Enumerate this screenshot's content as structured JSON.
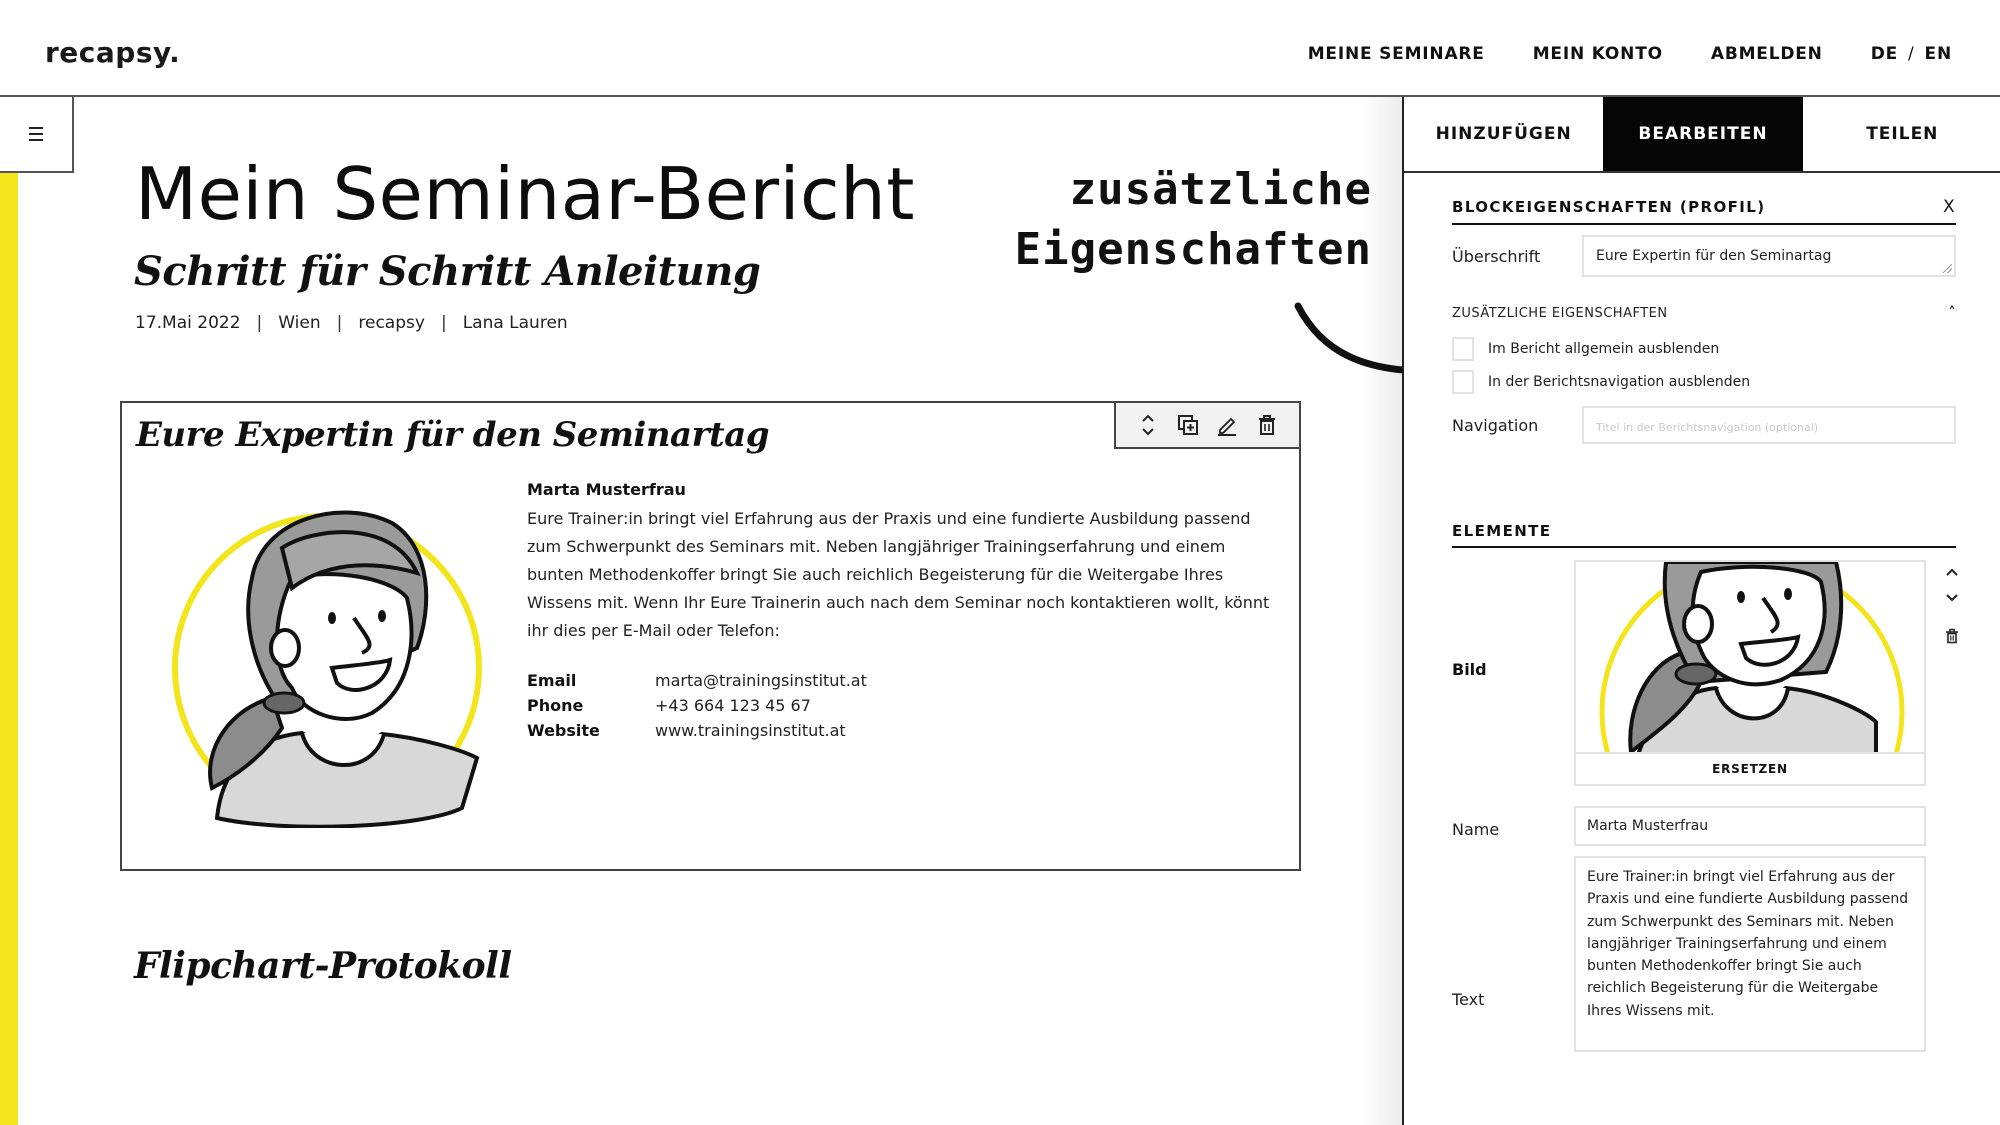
{
  "header": {
    "logo": "recapsy.",
    "nav": [
      {
        "label": "MEINE SEMINARE"
      },
      {
        "label": "MEIN KONTO"
      },
      {
        "label": "ABMELDEN"
      }
    ],
    "language": {
      "de": "DE",
      "separator": "/",
      "en": "EN"
    }
  },
  "sidebar_toggle": {
    "icon": "hamburger-menu-icon"
  },
  "main": {
    "title": "Mein Seminar-Bericht",
    "subtitle": "Schritt für Schritt Anleitung",
    "meta": {
      "date": "17.Mai 2022",
      "location": "Wien",
      "organizer": "recapsy",
      "author": "Lana Lauren",
      "separator": "|"
    },
    "annotation": {
      "line1": "zusätzliche",
      "line2": "Eigenschaften"
    },
    "profile_block": {
      "heading": "Eure Expertin für den Seminartag",
      "toolbar": [
        "move-up-down-icon",
        "duplicate-icon",
        "edit-pencil-icon",
        "trash-icon"
      ],
      "name": "Marta Musterfrau",
      "text": "Eure Trainer:in bringt viel Erfahrung aus der Praxis und eine fundierte Ausbildung passend zum Schwerpunkt des Seminars mit. Neben langjähriger Trainingserfahrung und einem bunten Methodenkoffer bringt Sie auch reichlich Begeisterung für die Weitergabe Ihres Wissens mit. Wenn Ihr Eure Trainerin auch nach dem Seminar noch kontaktieren wollt, könnt ihr dies per E-Mail oder Telefon:",
      "contacts": [
        {
          "label": "Email",
          "value": "marta@trainingsinstitut.at"
        },
        {
          "label": "Phone",
          "value": "+43 664 123 45 67"
        },
        {
          "label": "Website",
          "value": "www.trainingsinstitut.at"
        }
      ],
      "accent_color": "#f2e51c"
    },
    "next_section_heading": "Flipchart-Protokoll"
  },
  "panel": {
    "tabs": [
      {
        "label": "HINZUFÜGEN",
        "active": false
      },
      {
        "label": "BEARBEITEN",
        "active": true
      },
      {
        "label": "TEILEN",
        "active": false
      }
    ],
    "block_properties": {
      "title": "BLOCKEIGENSCHAFTEN (PROFIL)",
      "close": "X",
      "heading_label": "Überschrift",
      "heading_value": "Eure Expertin für den Seminartag",
      "extra_title": "ZUSÄTZLICHE EIGENSCHAFTEN",
      "checkboxes": [
        {
          "label": "Im Bericht allgemein ausblenden",
          "checked": false
        },
        {
          "label": "In der Berichtsnavigation ausblenden",
          "checked": false
        }
      ],
      "navigation_label": "Navigation",
      "navigation_placeholder": "Titel in der Berichtsnavigation (optional)"
    },
    "elements": {
      "title": "ELEMENTE",
      "image_label": "Bild",
      "replace_label": "ERSETZEN",
      "name_label": "Name",
      "name_value": "Marta Musterfrau",
      "text_label": "Text",
      "text_value": "Eure Trainer:in bringt viel Erfahrung aus der Praxis und eine fundierte Ausbildung passend zum Schwerpunkt des Seminars mit. Neben langjähriger Trainingserfahrung und einem bunten Methodenkoffer bringt Sie auch reichlich Begeisterung für die Weitergabe Ihres Wissens mit."
    }
  },
  "colors": {
    "accent_yellow": "#f2e51c",
    "active_tab_bg": "#050505",
    "text": "#111111"
  }
}
